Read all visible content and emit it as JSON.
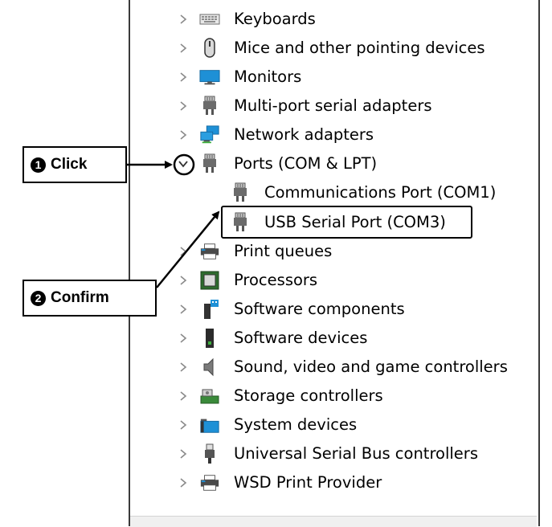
{
  "tree": {
    "items": [
      {
        "label": "Keyboards",
        "icon": "keyboard-icon",
        "expanded": false
      },
      {
        "label": "Mice and other pointing devices",
        "icon": "mouse-icon",
        "expanded": false
      },
      {
        "label": "Monitors",
        "icon": "monitor-icon",
        "expanded": false
      },
      {
        "label": "Multi-port serial adapters",
        "icon": "port-icon",
        "expanded": false
      },
      {
        "label": "Network adapters",
        "icon": "network-icon",
        "expanded": false
      },
      {
        "label": "Ports (COM & LPT)",
        "icon": "port-icon",
        "expanded": true
      },
      {
        "label": "Communications Port (COM1)",
        "icon": "port-icon",
        "child": true
      },
      {
        "label": "USB Serial Port (COM3)",
        "icon": "port-icon",
        "child": true
      },
      {
        "label": "Print queues",
        "icon": "printer-icon",
        "expanded": false
      },
      {
        "label": "Processors",
        "icon": "processor-icon",
        "expanded": false
      },
      {
        "label": "Software components",
        "icon": "software-component-icon",
        "expanded": false
      },
      {
        "label": "Software devices",
        "icon": "software-device-icon",
        "expanded": false
      },
      {
        "label": "Sound, video and game controllers",
        "icon": "speaker-icon",
        "expanded": false
      },
      {
        "label": "Storage controllers",
        "icon": "storage-icon",
        "expanded": false
      },
      {
        "label": "System devices",
        "icon": "system-folder-icon",
        "expanded": false
      },
      {
        "label": "Universal Serial Bus controllers",
        "icon": "usb-icon",
        "expanded": false
      },
      {
        "label": "WSD Print Provider",
        "icon": "printer-icon",
        "expanded": false
      }
    ]
  },
  "callouts": {
    "click": {
      "number": "1",
      "text": "Click"
    },
    "confirm": {
      "number": "2",
      "text": "Confirm"
    }
  },
  "colors": {
    "accent": "#000000",
    "monitor_blue": "#1e90d6",
    "chevron": "#8a8a8a"
  }
}
